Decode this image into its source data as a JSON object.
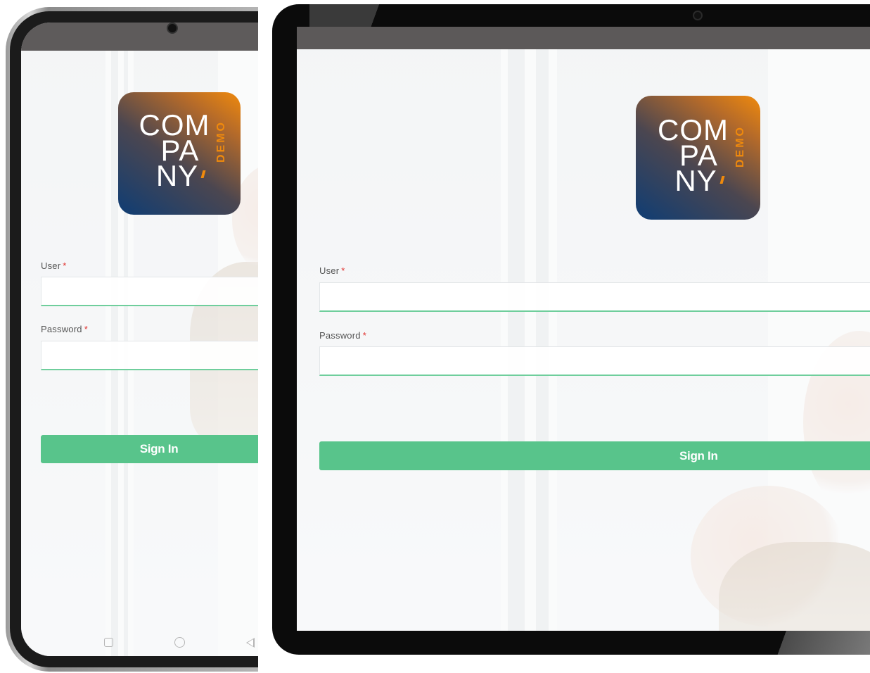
{
  "phone": {
    "logo": {
      "line1": "COM",
      "line2": "PA",
      "line3": "NY",
      "badge": "DEMO"
    },
    "form": {
      "user_label": "User",
      "password_label": "Password",
      "required_mark": "*",
      "user_value": "",
      "password_value": "",
      "sign_in_label": "Sign In"
    },
    "nav": [
      "recent-apps",
      "home",
      "back"
    ]
  },
  "tablet": {
    "logo": {
      "line1": "COM",
      "line2": "PA",
      "line3": "NY",
      "badge": "DEMO"
    },
    "form": {
      "user_label": "User",
      "password_label": "Password",
      "required_mark": "*",
      "user_value": "",
      "password_value": "",
      "sign_in_label": "Sign In"
    }
  },
  "colors": {
    "accent_green": "#58c48b",
    "field_underline": "#6fce9c",
    "required_red": "#e0312e",
    "logo_orange": "#f08a0c",
    "logo_blue": "#0f3d74"
  }
}
